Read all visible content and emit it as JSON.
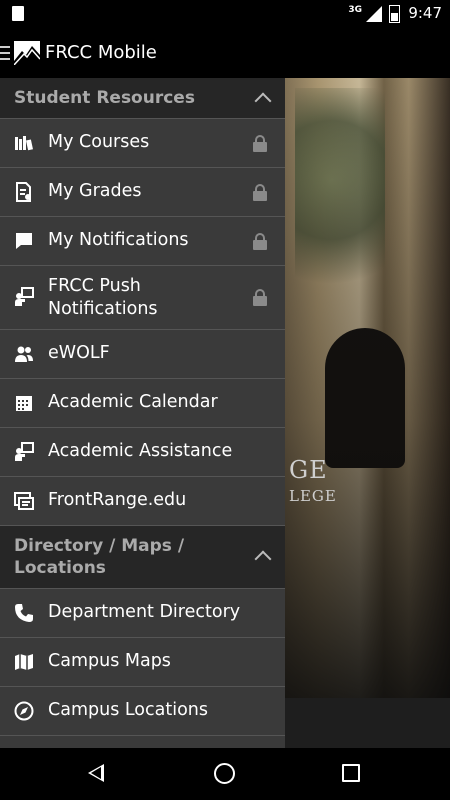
{
  "status_bar": {
    "network": "3G",
    "time": "9:47",
    "icons": [
      "sd-card-icon",
      "signal-icon",
      "battery-icon"
    ]
  },
  "app_bar": {
    "title": "FRCC Mobile",
    "icons": [
      "menu-icon",
      "frcc-logo"
    ]
  },
  "background": {
    "watermark_line1": "GE",
    "watermark_line2": "LEGE"
  },
  "drawer": {
    "sections": [
      {
        "title": "Student Resources",
        "expanded": true,
        "items": [
          {
            "label": "My Courses",
            "icon": "books-icon",
            "locked": true
          },
          {
            "label": "My Grades",
            "icon": "grade-document-icon",
            "locked": true
          },
          {
            "label": "My Notifications",
            "icon": "chat-bubble-icon",
            "locked": true
          },
          {
            "label": "FRCC Push Notifications",
            "icon": "presenter-icon",
            "locked": true
          },
          {
            "label": "eWOLF",
            "icon": "people-icon",
            "locked": false
          },
          {
            "label": "Academic Calendar",
            "icon": "calendar-icon",
            "locked": false
          },
          {
            "label": "Academic Assistance",
            "icon": "presenter-icon",
            "locked": false
          },
          {
            "label": "FrontRange.edu",
            "icon": "website-icon",
            "locked": false
          }
        ]
      },
      {
        "title": "Directory / Maps / Locations",
        "expanded": true,
        "items": [
          {
            "label": "Department Directory",
            "icon": "phone-icon",
            "locked": false
          },
          {
            "label": "Campus Maps",
            "icon": "map-icon",
            "locked": false
          },
          {
            "label": "Campus Locations",
            "icon": "compass-icon",
            "locked": false
          }
        ]
      }
    ]
  },
  "nav_bar": {
    "icons": [
      "back-icon",
      "home-icon",
      "recent-apps-icon"
    ]
  }
}
